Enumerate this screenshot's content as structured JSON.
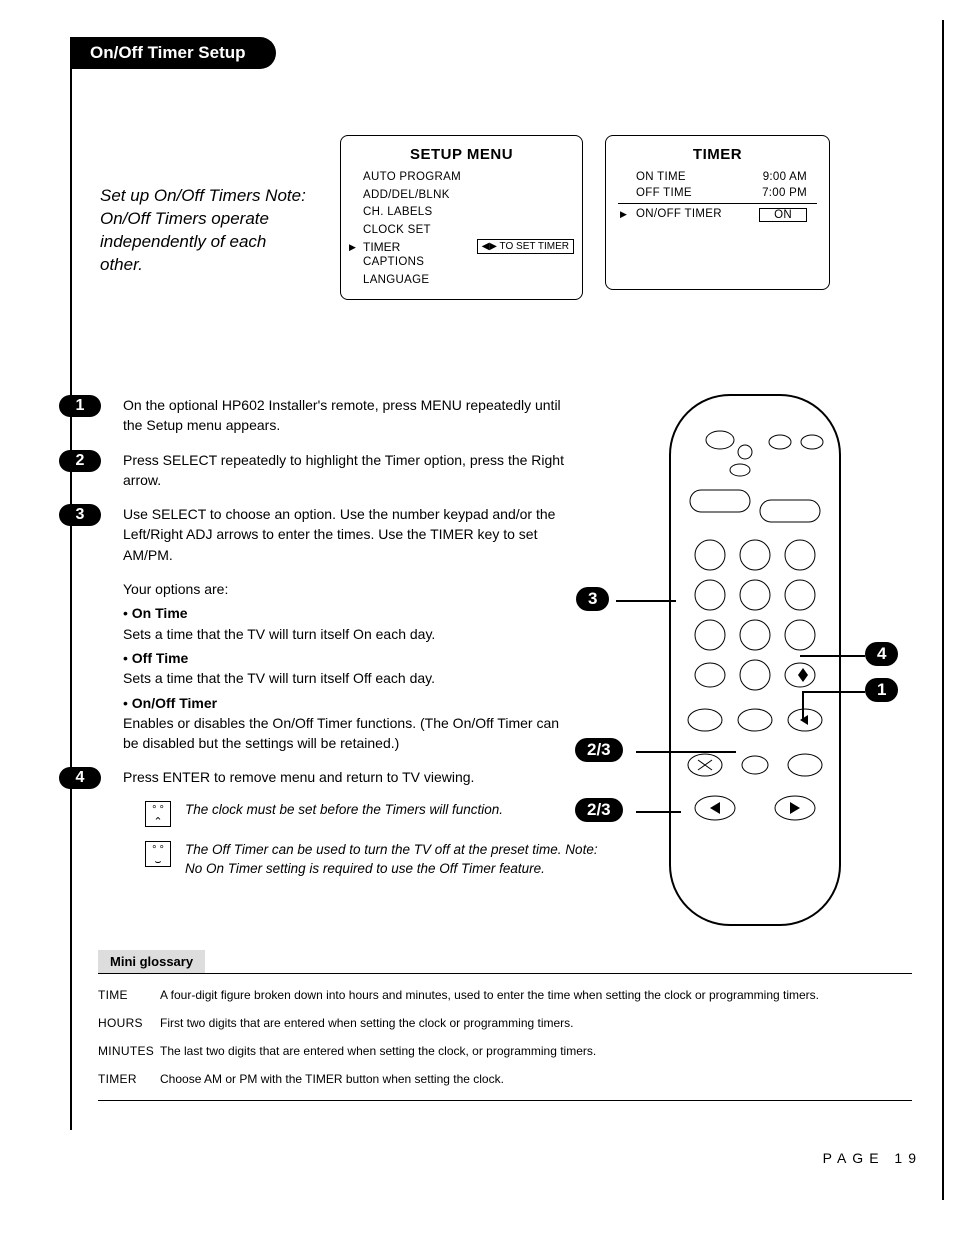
{
  "header": {
    "title": "On/Off Timer Setup"
  },
  "intro": "Set up On/Off Timers Note: On/Off Timers operate independently of each other.",
  "setup_menu": {
    "title": "SETUP MENU",
    "items": [
      "AUTO PROGRAM",
      "ADD/DEL/BLNK",
      "CH. LABELS",
      "CLOCK SET"
    ],
    "selected_label": "TIMER",
    "selected_hint": "◀▶ TO SET TIMER",
    "items_after": [
      "CAPTIONS",
      "LANGUAGE"
    ]
  },
  "timer_menu": {
    "title": "TIMER",
    "rows": [
      {
        "label": "ON TIME",
        "value": "9:00 AM"
      },
      {
        "label": "OFF TIME",
        "value": "7:00 PM"
      }
    ],
    "sel": {
      "label": "ON/OFF TIMER",
      "value": "ON"
    }
  },
  "steps": [
    {
      "n": "1",
      "text": "On the optional HP602 Installer's remote, press MENU repeatedly until the Setup menu appears."
    },
    {
      "n": "2",
      "text": "Press SELECT repeatedly to highlight the Timer option, press the Right arrow."
    },
    {
      "n": "3",
      "text": "Use SELECT to choose an option. Use the number keypad and/or the Left/Right ADJ arrows to enter the times. Use the TIMER key to set AM/PM."
    }
  ],
  "options_intro": "Your options are:",
  "options": [
    {
      "name": "On Time",
      "desc": "Sets a time that the TV will turn itself On each day."
    },
    {
      "name": "Off Time",
      "desc": "Sets a time that the TV will turn itself Off each day."
    },
    {
      "name": "On/Off Timer",
      "desc": "Enables or disables the On/Off Timer functions. (The On/Off Timer can be disabled but the settings will be retained.)"
    }
  ],
  "step4": {
    "n": "4",
    "text": "Press ENTER to remove menu and return to TV viewing."
  },
  "notes": [
    {
      "icon": "sad",
      "text": "The clock must be set before the Timers will function."
    },
    {
      "icon": "happy",
      "text": "The Off Timer can be used to turn the TV off at the preset time. Note: No On Timer setting is required to use the Off Timer feature."
    }
  ],
  "callouts": {
    "left_top": "3",
    "left_mid": "2/3",
    "left_bot": "2/3",
    "right_top": "4",
    "right_bot": "1"
  },
  "glossary": {
    "title": "Mini glossary",
    "rows": [
      {
        "term": "TIME",
        "def": "A four-digit figure broken down into hours and minutes, used to enter the time when setting the clock or programming timers."
      },
      {
        "term": "HOURS",
        "def": "First two digits that are entered when setting the clock or programming timers."
      },
      {
        "term": "MINUTES",
        "def": "The last two digits that are entered when setting the clock, or programming timers."
      },
      {
        "term": "TIMER",
        "def": "Choose AM or PM with the TIMER button when setting the clock."
      }
    ]
  },
  "page_number": "PAGE 19"
}
